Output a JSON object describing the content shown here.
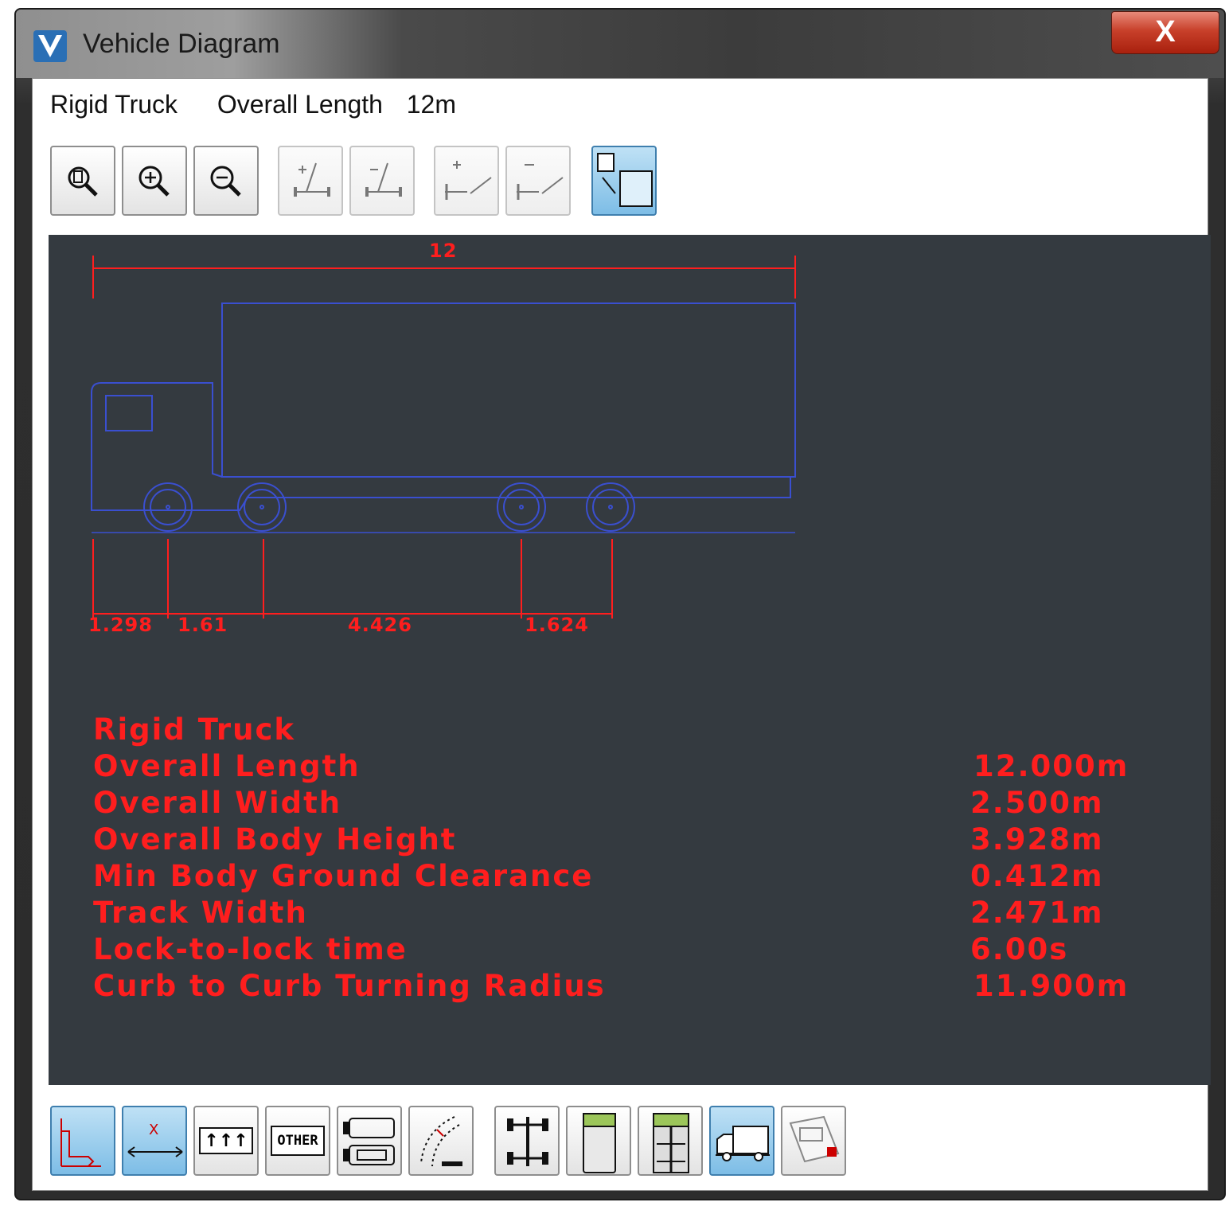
{
  "window": {
    "title": "Vehicle Diagram",
    "close_label": "X"
  },
  "info": {
    "vehicle_type": "Rigid Truck",
    "length_label": "Overall Length",
    "length_value": "12m"
  },
  "diagram": {
    "overall_dimension": "12",
    "axle_spacings": [
      "1.298",
      "1.61",
      "4.426",
      "1.624"
    ],
    "vehicle_title": "Rigid Truck",
    "specs": [
      {
        "label": "Overall Length",
        "value": "12.000m"
      },
      {
        "label": "Overall Width",
        "value": "2.500m"
      },
      {
        "label": "Overall Body Height",
        "value": "3.928m"
      },
      {
        "label": "Min Body Ground Clearance",
        "value": "0.412m"
      },
      {
        "label": "Track Width",
        "value": "2.471m"
      },
      {
        "label": "Lock-to-lock time",
        "value": "6.00s"
      },
      {
        "label": "Curb to Curb Turning Radius",
        "value": "11.900m"
      }
    ],
    "colors": {
      "background": "#343a40",
      "outline": "#3a4fd0",
      "dimension": "#ff1e1e"
    }
  },
  "bottom_toolbar": {
    "lane_label": "↑↑↑",
    "other_label": "OTHER"
  },
  "icons": {
    "top": [
      "zoom-extents-icon",
      "zoom-in-icon",
      "zoom-out-icon",
      "add-axle-icon",
      "remove-axle-icon",
      "add-steer-axle-icon",
      "remove-steer-axle-icon",
      "resize-view-icon"
    ],
    "bottom": [
      "side-view-icon",
      "dimension-icon",
      "lane-arrows-icon",
      "other-icon",
      "vehicle-parts-icon",
      "swept-path-icon",
      "axle-plan-icon",
      "top-body-icon",
      "chassis-icon",
      "truck-side-icon",
      "report-icon"
    ]
  }
}
